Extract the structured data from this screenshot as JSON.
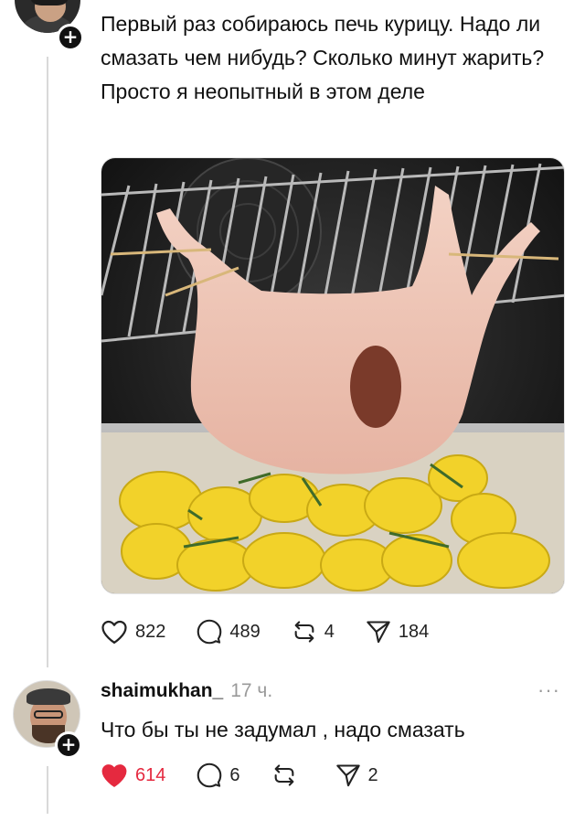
{
  "post": {
    "text": "Первый раз собираюсь печь курицу. Надо ли смазать чем нибудь? Сколько минут жарить? Просто я неопытный в этом деле",
    "image_alt": "raw-chicken-hanging-on-oven-rack-over-potatoes",
    "likes": "822",
    "comments": "489",
    "reposts": "4",
    "shares": "184"
  },
  "reply": {
    "username": "shaimukhan_",
    "time": "17 ч.",
    "more": "···",
    "text": "Что бы ты не задумал , надо смазать",
    "likes": "614",
    "comments": "6",
    "reposts": "",
    "shares": "2"
  },
  "colors": {
    "like_active": "#e5293f",
    "muted": "#9a9a9a",
    "thread_line": "#d9d9d9"
  },
  "icons": {
    "heart": "heart-icon",
    "comment": "comment-icon",
    "repost": "repost-icon",
    "share": "share-icon",
    "follow": "plus-icon"
  }
}
